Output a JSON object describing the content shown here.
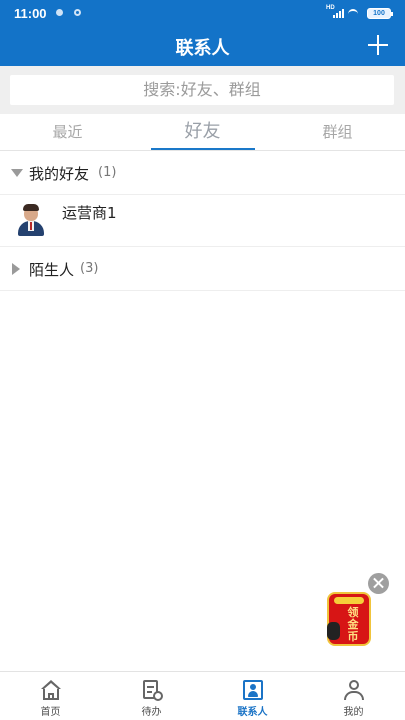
{
  "status_bar": {
    "time": "11:00",
    "network": "HD",
    "battery": "100"
  },
  "header": {
    "title": "联系人",
    "add_icon": "plus-icon"
  },
  "search": {
    "placeholder": "搜索:好友、群组"
  },
  "tabs": [
    {
      "label": "最近",
      "active": false
    },
    {
      "label": "好友",
      "active": true
    },
    {
      "label": "群组",
      "active": false
    }
  ],
  "groups": [
    {
      "name": "我的好友",
      "count": "(1)",
      "expanded": true
    },
    {
      "name": "陌生人",
      "count": "(3)",
      "expanded": false
    }
  ],
  "contacts": [
    {
      "name": "运营商1",
      "avatar": "business-man-avatar"
    }
  ],
  "ad": {
    "text": "领金币",
    "close_icon": "close-icon"
  },
  "bottom_nav": [
    {
      "label": "首页",
      "icon": "home-icon",
      "active": false
    },
    {
      "label": "待办",
      "icon": "todo-icon",
      "active": false
    },
    {
      "label": "联系人",
      "icon": "contacts-icon",
      "active": true
    },
    {
      "label": "我的",
      "icon": "user-icon",
      "active": false
    }
  ],
  "colors": {
    "primary": "#1373c8",
    "active_tab": "#1a78c9",
    "text": "#222222",
    "muted": "#9b9b9b",
    "ad_red": "#d71515"
  }
}
